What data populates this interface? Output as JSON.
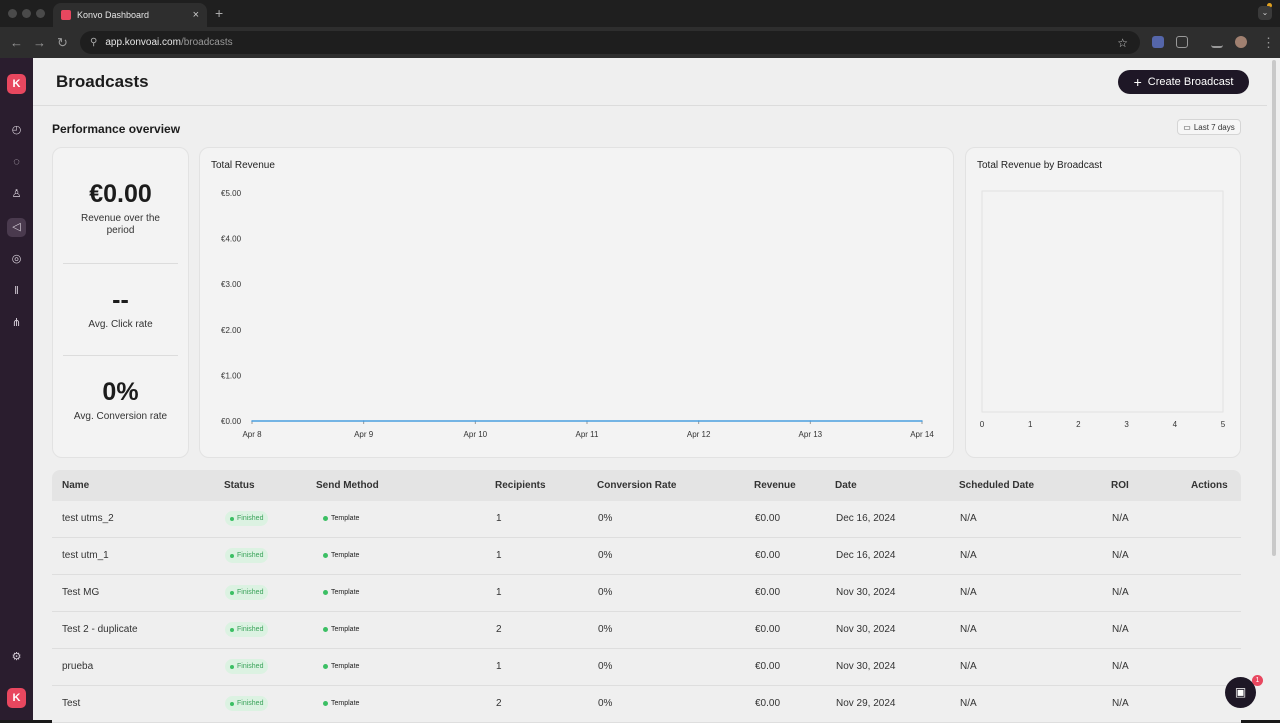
{
  "browser": {
    "tab_title": "Konvo Dashboard",
    "url_host": "app.konvoai.com",
    "url_path": "/broadcasts"
  },
  "sidebar": {
    "items": [
      {
        "icon": "dashboard-icon",
        "glyph": "◴"
      },
      {
        "icon": "chat-icon",
        "glyph": "◌"
      },
      {
        "icon": "contacts-icon",
        "glyph": "♙"
      },
      {
        "icon": "megaphone-icon",
        "glyph": "◁",
        "active": true
      },
      {
        "icon": "lightbulb-icon",
        "glyph": "◎"
      },
      {
        "icon": "library-icon",
        "glyph": "‖"
      },
      {
        "icon": "flow-icon",
        "glyph": "⋔"
      }
    ],
    "settings_glyph": "⚙",
    "logo_glyph": "K"
  },
  "header": {
    "title": "Broadcasts",
    "create_label": "Create Broadcast"
  },
  "overview": {
    "title": "Performance overview",
    "range_label": "Last 7 days"
  },
  "kpis": [
    {
      "value": "€0.00",
      "label": "Revenue over the period"
    },
    {
      "value": "--",
      "label": "Avg. Click rate"
    },
    {
      "value": "0%",
      "label": "Avg. Conversion rate"
    }
  ],
  "charts": {
    "revenue_title": "Total Revenue",
    "broadcast_title": "Total Revenue by Broadcast"
  },
  "chart_data": [
    {
      "type": "line",
      "title": "Total Revenue",
      "x": [
        "Apr 8",
        "Apr 9",
        "Apr 10",
        "Apr 11",
        "Apr 12",
        "Apr 13",
        "Apr 14"
      ],
      "series": [
        {
          "values": [
            0,
            0,
            0,
            0,
            0,
            0,
            0
          ],
          "color": "#4a9fe0"
        }
      ],
      "yticks": [
        "€0.00",
        "€1.00",
        "€2.00",
        "€3.00",
        "€4.00",
        "€5.00"
      ],
      "ylim": [
        0,
        5
      ]
    },
    {
      "type": "bar",
      "title": "Total Revenue by Broadcast",
      "categories": [],
      "values": [],
      "xticks": [
        "0",
        "1",
        "2",
        "3",
        "4",
        "5"
      ],
      "xlim": [
        0,
        5
      ]
    }
  ],
  "table": {
    "columns": [
      "Name",
      "Status",
      "Send Method",
      "Recipients",
      "Conversion Rate",
      "Revenue",
      "Date",
      "Scheduled Date",
      "ROI",
      "Actions"
    ],
    "rows": [
      {
        "name": "test utms_2",
        "status": "Finished",
        "method": "Template",
        "recipients": "1",
        "conversion": "0%",
        "revenue": "€0.00",
        "date": "Dec 16, 2024",
        "scheduled": "N/A",
        "roi": "N/A"
      },
      {
        "name": "test utm_1",
        "status": "Finished",
        "method": "Template",
        "recipients": "1",
        "conversion": "0%",
        "revenue": "€0.00",
        "date": "Dec 16, 2024",
        "scheduled": "N/A",
        "roi": "N/A"
      },
      {
        "name": "Test MG",
        "status": "Finished",
        "method": "Template",
        "recipients": "1",
        "conversion": "0%",
        "revenue": "€0.00",
        "date": "Nov 30, 2024",
        "scheduled": "N/A",
        "roi": "N/A"
      },
      {
        "name": "Test 2 - duplicate",
        "status": "Finished",
        "method": "Template",
        "recipients": "2",
        "conversion": "0%",
        "revenue": "€0.00",
        "date": "Nov 30, 2024",
        "scheduled": "N/A",
        "roi": "N/A"
      },
      {
        "name": "prueba",
        "status": "Finished",
        "method": "Template",
        "recipients": "1",
        "conversion": "0%",
        "revenue": "€0.00",
        "date": "Nov 30, 2024",
        "scheduled": "N/A",
        "roi": "N/A"
      },
      {
        "name": "Test",
        "status": "Finished",
        "method": "Template",
        "recipients": "2",
        "conversion": "0%",
        "revenue": "€0.00",
        "date": "Nov 29, 2024",
        "scheduled": "N/A",
        "roi": "N/A"
      }
    ]
  },
  "chat": {
    "badge_count": "1"
  }
}
